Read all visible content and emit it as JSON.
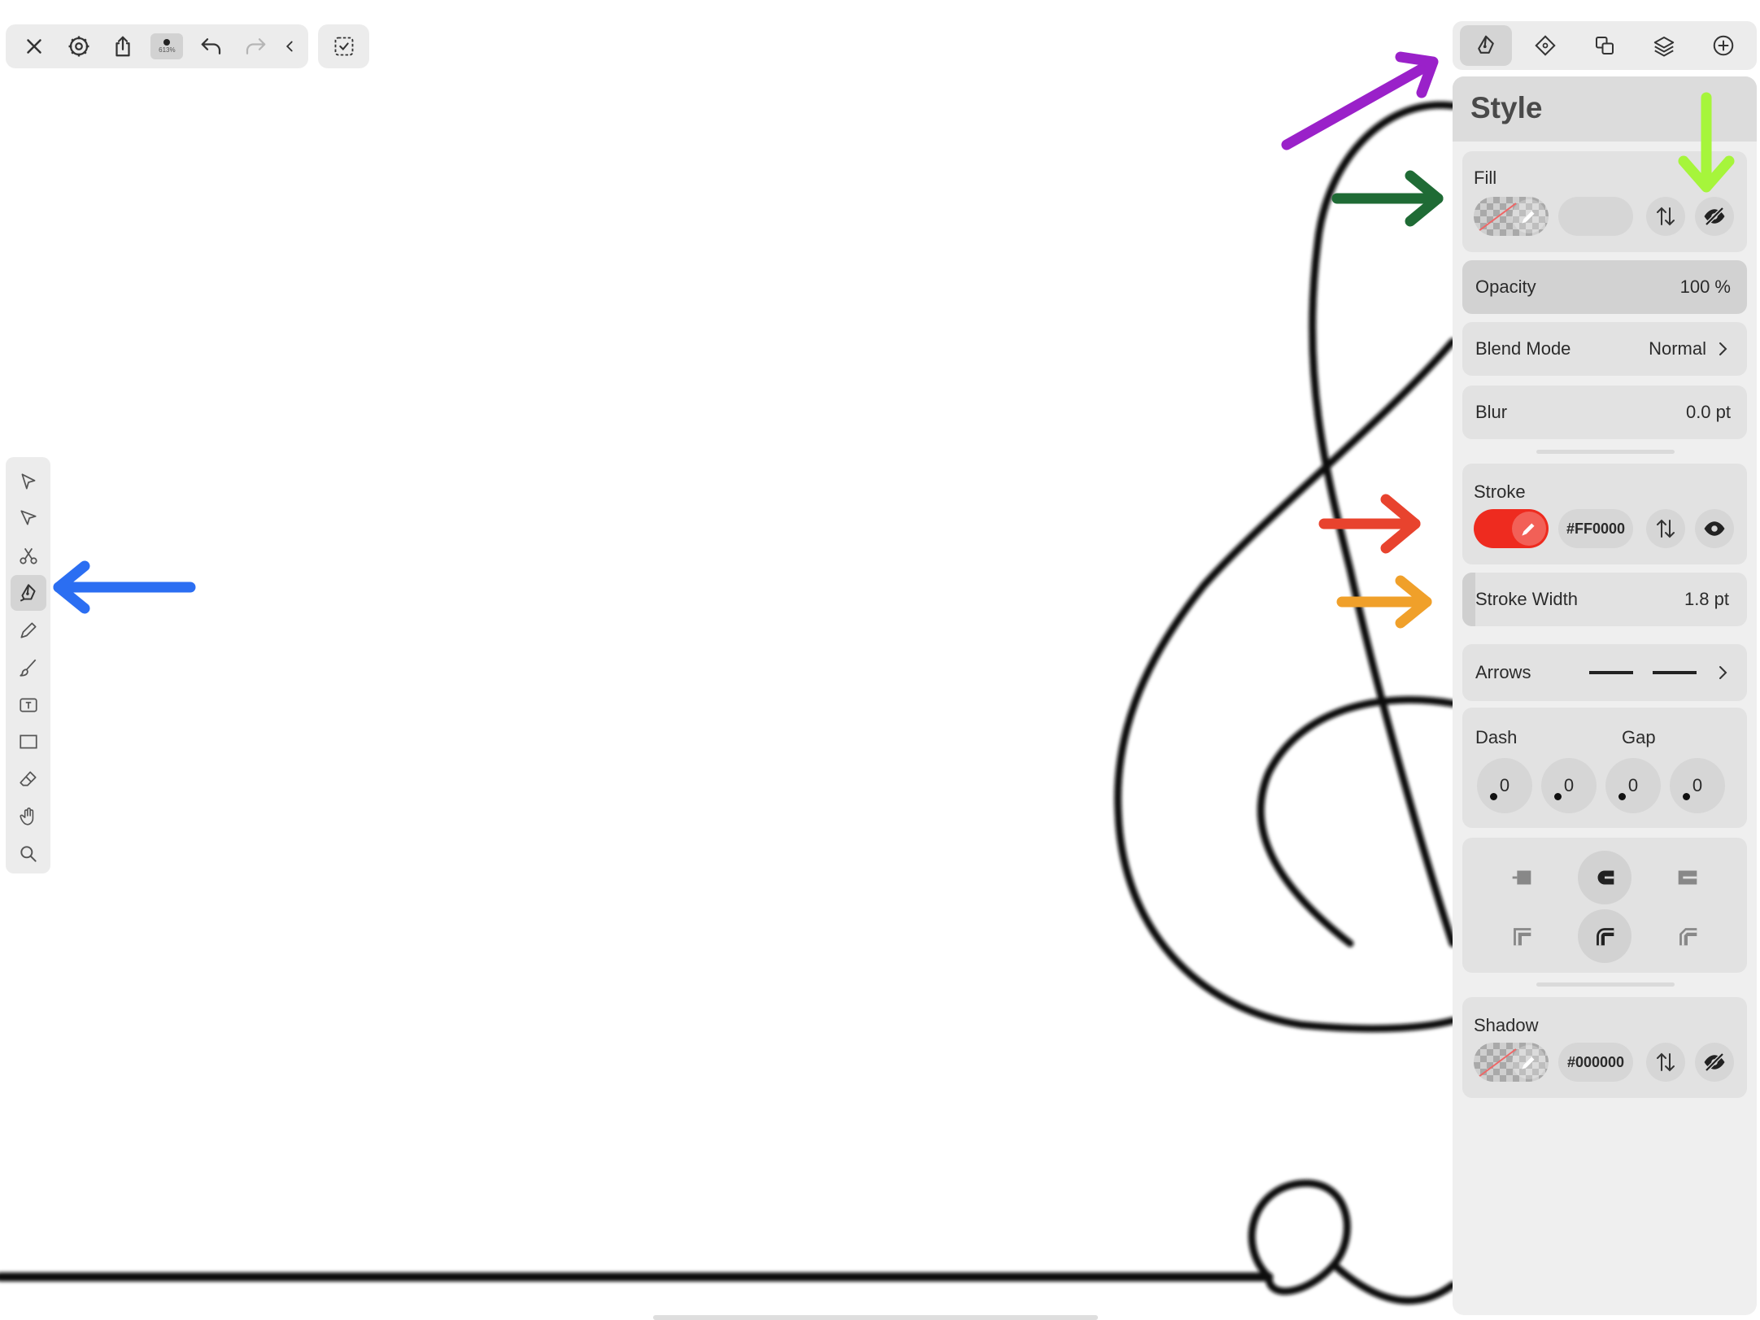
{
  "toolbar": {
    "zoom_label": "613%"
  },
  "panel": {
    "title": "Style",
    "fill": {
      "label": "Fill"
    },
    "opacity": {
      "label": "Opacity",
      "value": "100 %"
    },
    "blend_mode": {
      "label": "Blend Mode",
      "value": "Normal"
    },
    "blur": {
      "label": "Blur",
      "value": "0.0 pt"
    },
    "stroke": {
      "label": "Stroke",
      "hex": "#FF0000",
      "color": "#ee2b1f"
    },
    "stroke_width": {
      "label": "Stroke Width",
      "value": "1.8 pt"
    },
    "arrows": {
      "label": "Arrows"
    },
    "dash_gap": {
      "dash_label": "Dash",
      "gap_label": "Gap",
      "values": [
        "0",
        "0",
        "0",
        "0"
      ]
    },
    "shadow": {
      "label": "Shadow",
      "hex": "#000000"
    }
  },
  "annotations": {
    "colors": [
      "#9a21c9",
      "#1f6b35",
      "#a6f53b",
      "#e8432e",
      "#f0a02a",
      "#2b6ef2"
    ]
  },
  "icons": {
    "toolbar": [
      "close-icon",
      "gear-icon",
      "share-icon",
      "undo-icon",
      "redo-icon",
      "chevron-left-icon",
      "select-check-icon"
    ],
    "tools": [
      "select-arrow-icon",
      "direct-select-icon",
      "scissors-icon",
      "pen-icon",
      "pencil-icon",
      "brush-icon",
      "text-icon",
      "rectangle-icon",
      "eraser-icon",
      "hand-icon",
      "zoom-icon"
    ],
    "tabs": [
      "style-icon",
      "path-icon",
      "arrange-icon",
      "layers-icon",
      "add-icon"
    ]
  }
}
